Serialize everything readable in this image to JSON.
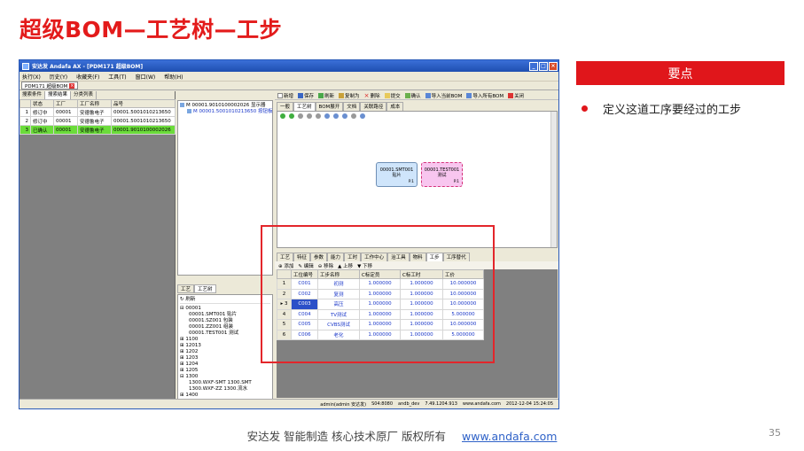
{
  "slide": {
    "title": "超级BOM—工艺树—工步",
    "page_number": "35"
  },
  "footer": {
    "text": "安达发 智能制造 核心技术原厂 版权所有",
    "link": "www.andafa.com"
  },
  "key_points": {
    "header": "要点",
    "items": [
      "定义这道工序要经过的工步"
    ]
  },
  "app": {
    "window_title": "安达发 Andafa AX - [PDM171 超级BOM]",
    "menu": [
      "执行(X)",
      "历史(Y)",
      "收藏夹(F)",
      "工具(T)",
      "窗口(W)",
      "帮助(H)"
    ],
    "doc_tab": "PDM171 超级BOM",
    "left": {
      "tabs": [
        "搜索条件",
        "搜索结果",
        "分类列表"
      ],
      "columns": [
        "",
        "状态",
        "工厂",
        "工厂名称",
        "品号"
      ],
      "rows": [
        {
          "no": "1",
          "status": "修订中",
          "factory": "00001",
          "factory_name": "安德鲁电子",
          "item": "00001.5001010213650"
        },
        {
          "no": "2",
          "status": "修订中",
          "factory": "00001",
          "factory_name": "安德鲁电子",
          "item": "00001.5001010213650"
        },
        {
          "no": "3",
          "status": "已确认",
          "factory": "00001",
          "factory_name": "安德鲁电子",
          "item": "00001.9010100002026"
        }
      ]
    },
    "mid": {
      "tree_top": [
        "M 00001.9010100002026 显示器",
        "M 00001.5001010213650 按钮板"
      ],
      "bottom_tabs": [
        "工艺",
        "工艺树"
      ],
      "refresh": "刷新",
      "tree_bottom": [
        "00001",
        "00001.SMT001 贴片",
        "00001.SZ001 包装",
        "00001.ZZ001 组装",
        "00001.TEST001 测试",
        "1100",
        "12013",
        "1202",
        "1203",
        "1204",
        "1205",
        "1300",
        "1300.WXF-SMT 1300.SMT",
        "1300.WXF-ZZ 1300.流水",
        "1400",
        "1901"
      ]
    },
    "right": {
      "toolbar": [
        "新增",
        "保存",
        "刷新",
        "复制为",
        "删除",
        "提交",
        "确认",
        "导入当前BOM",
        "导入所有BOM",
        "关闭"
      ],
      "tabs": [
        "一般",
        "工艺树",
        "BOM展开",
        "文档",
        "关联路径",
        "成本"
      ],
      "nodes": [
        {
          "code": "00001.SMT001",
          "name": "贴片",
          "flag": "P.1"
        },
        {
          "code": "00001.TEST001",
          "name": "测试",
          "flag": "P.1"
        }
      ],
      "bottom_tabs": [
        "工艺",
        "特征",
        "参数",
        "能力",
        "工时",
        "工作中心",
        "治工具",
        "物料",
        "工步",
        "工序替代"
      ],
      "step_toolbar": [
        "添加",
        "编辑",
        "移除",
        "上移",
        "下移"
      ],
      "step_columns": [
        "",
        "工位编号",
        "工步名称",
        "C标定员",
        "C标工时",
        "工价"
      ],
      "steps": [
        {
          "no": "1",
          "code": "C001",
          "name": "初测",
          "a": "1.000000",
          "b": "1.000000",
          "c": "10.000000"
        },
        {
          "no": "2",
          "code": "C002",
          "name": "复测",
          "a": "1.000000",
          "b": "1.000000",
          "c": "10.000000"
        },
        {
          "no": "3",
          "code": "C003",
          "name": "高压",
          "a": "1.000000",
          "b": "1.000000",
          "c": "10.000000"
        },
        {
          "no": "4",
          "code": "C004",
          "name": "TV测试",
          "a": "1.000000",
          "b": "1.000000",
          "c": "5.000000"
        },
        {
          "no": "5",
          "code": "C005",
          "name": "CVBS测试",
          "a": "1.000000",
          "b": "1.000000",
          "c": "10.000000"
        },
        {
          "no": "6",
          "code": "C006",
          "name": "老化",
          "a": "1.000000",
          "b": "1.000000",
          "c": "5.000000"
        }
      ]
    },
    "status_bar": [
      "admin(admin 安达发)",
      "S04:8080",
      "andb_dev",
      "7.49.1204.913",
      "www.andafa.com",
      "2012-12-04 15:24:05"
    ]
  }
}
